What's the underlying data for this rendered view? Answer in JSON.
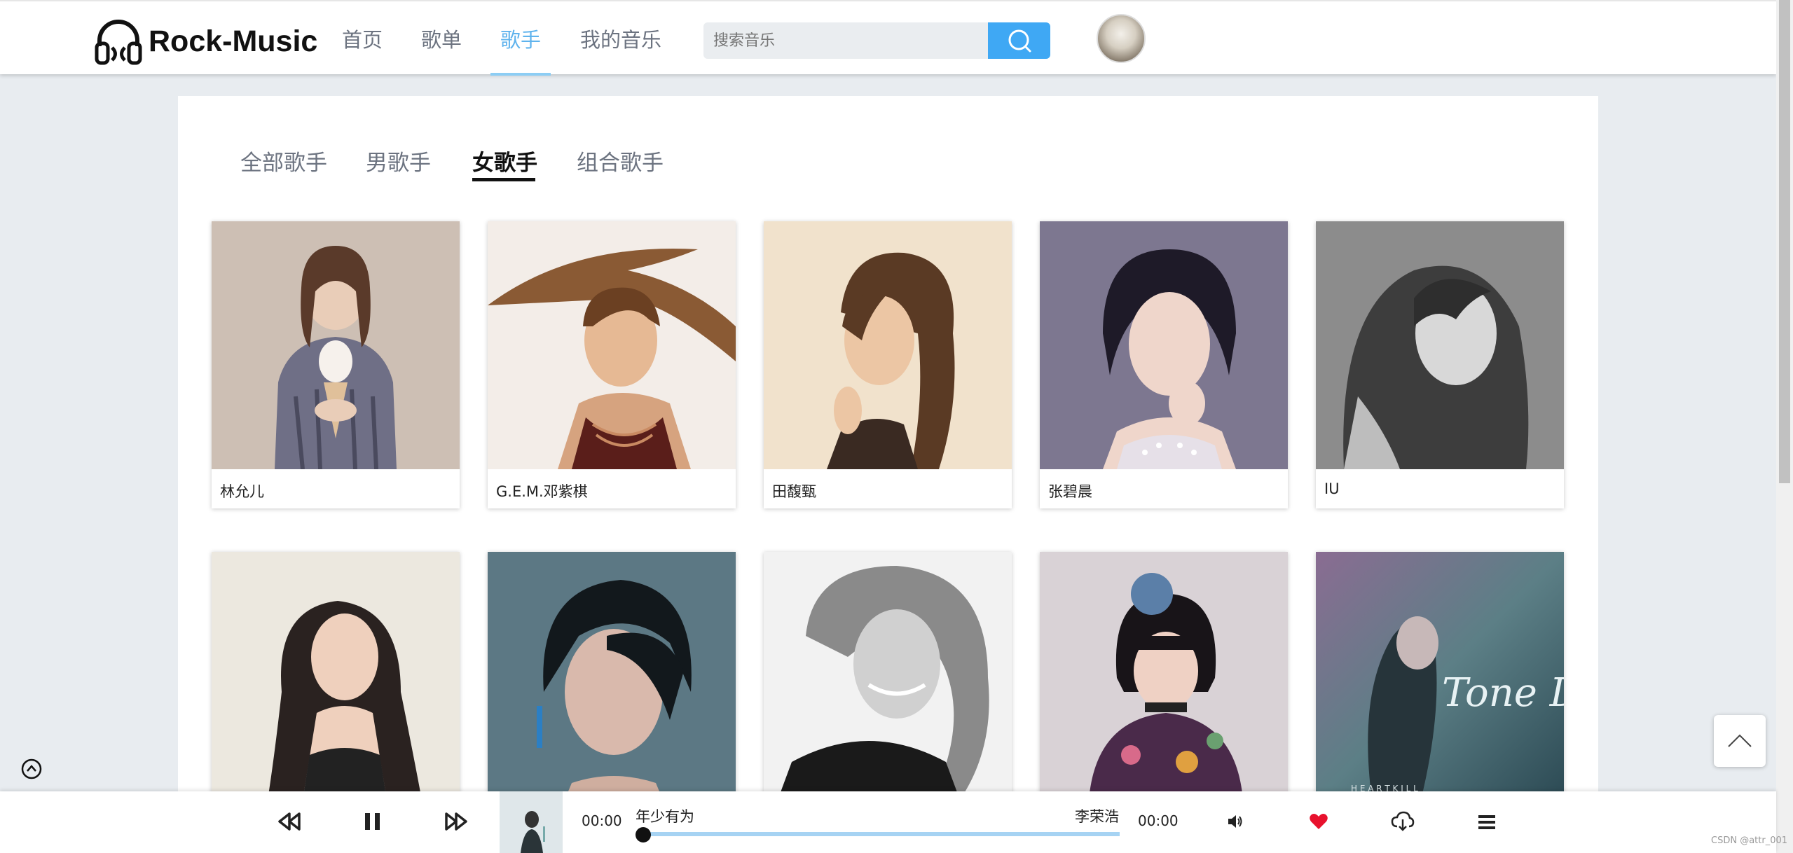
{
  "app": {
    "name": "Rock-Music"
  },
  "nav": {
    "items": [
      {
        "label": "首页"
      },
      {
        "label": "歌单"
      },
      {
        "label": "歌手"
      },
      {
        "label": "我的音乐"
      }
    ],
    "active_index": 2
  },
  "search": {
    "placeholder": "搜索音乐",
    "button_icon": "search-icon"
  },
  "user": {
    "avatar_icon": "avatar"
  },
  "tabs": {
    "items": [
      {
        "label": "全部歌手"
      },
      {
        "label": "男歌手"
      },
      {
        "label": "女歌手"
      },
      {
        "label": "组合歌手"
      }
    ],
    "active_index": 2
  },
  "singers": [
    {
      "name": "林允儿"
    },
    {
      "name": "G.E.M.邓紫棋"
    },
    {
      "name": "田馥甄"
    },
    {
      "name": "张碧晨"
    },
    {
      "name": "IU"
    },
    {
      "name": ""
    },
    {
      "name": ""
    },
    {
      "name": ""
    },
    {
      "name": ""
    },
    {
      "name": ""
    }
  ],
  "album_art_text": {
    "title": "Tone Damli",
    "subtitle": "H E A R T K I L L"
  },
  "player": {
    "current_time": "00:00",
    "total_time": "00:00",
    "song_title": "年少有为",
    "artist": "李荣浩",
    "progress": 0,
    "controls": [
      "prev-icon",
      "pause-icon",
      "next-icon",
      "volume-icon",
      "heart-icon",
      "download-icon",
      "playlist-icon"
    ]
  },
  "colors": {
    "accent": "#3fa8f4",
    "nav_active": "#5fb3ed",
    "progress": "#a6d3f3",
    "like": "#e8112d"
  },
  "watermark": "CSDN @attr_001"
}
